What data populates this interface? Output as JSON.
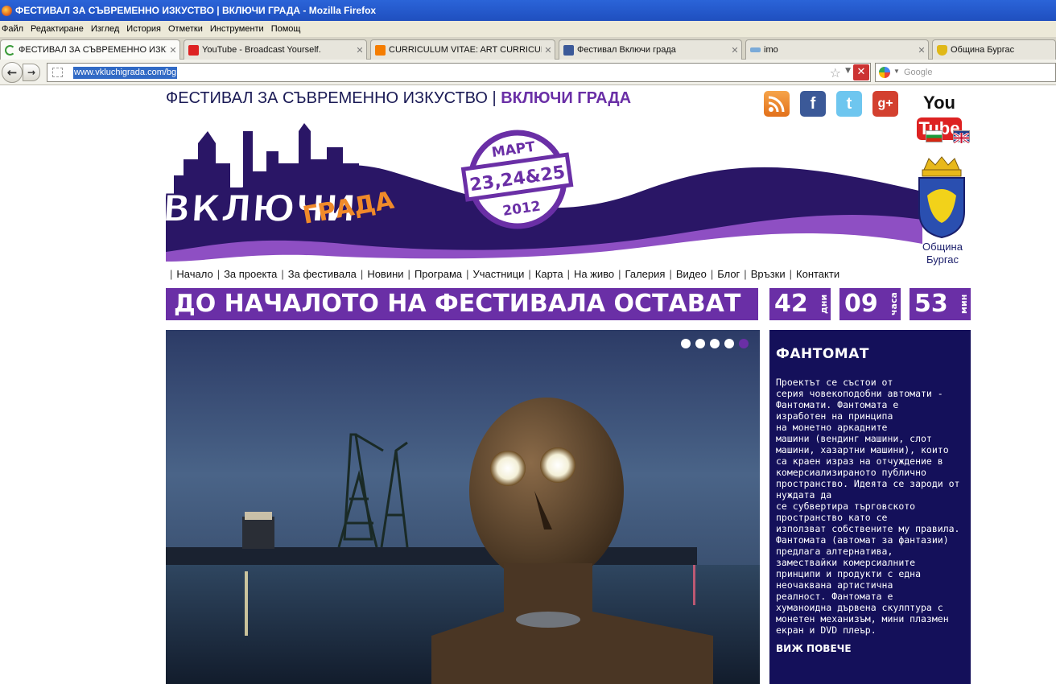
{
  "window": {
    "title": "ФЕСТИВАЛ ЗА СЪВРЕМЕННО ИЗКУСТВО | ВКЛЮЧИ ГРАДА - Mozilla Firefox"
  },
  "menu": [
    "Файл",
    "Редактиране",
    "Изглед",
    "История",
    "Отметки",
    "Инструменти",
    "Помощ"
  ],
  "tabs": [
    {
      "label": "ФЕСТИВАЛ ЗА СЪВРЕМЕННО ИЗКУС...",
      "icon": "loading-icon",
      "active": true
    },
    {
      "label": "YouTube - Broadcast Yourself.",
      "icon": "youtube-icon"
    },
    {
      "label": "CURRICULUM VITAE: ART CURRICUL...",
      "icon": "blogger-icon"
    },
    {
      "label": "Фестивал Включи града",
      "icon": "facebook-icon"
    },
    {
      "label": "imo",
      "icon": "imo-icon"
    },
    {
      "label": "Община Бургас",
      "icon": "crest-icon"
    }
  ],
  "navigation": {
    "url": "www.vkluchigrada.com/bg",
    "search_placeholder": "Google"
  },
  "site": {
    "heading_main": "ФЕСТИВАЛ ЗА СЪВРЕМЕННО ИЗКУСТВО",
    "heading_sep": "|",
    "heading_accent": "ВКЛЮЧИ ГРАДА",
    "social": [
      "rss-icon",
      "facebook-icon",
      "twitter-icon",
      "google-plus-icon",
      "youtube-icon"
    ],
    "youtube_label": "YouTube",
    "languages": [
      "bulgarian-flag-icon",
      "uk-flag-icon"
    ],
    "logo_text": "ВКЛЮЧИ ГРАДА",
    "stamp": {
      "month": "МАРТ",
      "days": "23,24&25",
      "year": "2012"
    },
    "municipality": [
      "Община",
      "Бургас"
    ]
  },
  "nav": [
    "Начало",
    "За проекта",
    "За фестивала",
    "Новини",
    "Програма",
    "Участници",
    "Карта",
    "На живо",
    "Галерия",
    "Видео",
    "Блог",
    "Връзки",
    "Контакти"
  ],
  "countdown": {
    "label": "ДО НАЧАЛОТО НА ФЕСТИВАЛА ОСТАВАТ",
    "days": "42",
    "days_unit": "дни",
    "hours": "09",
    "hours_unit": "часа",
    "minutes": "53",
    "minutes_unit": "мин"
  },
  "slider": {
    "total": 5,
    "active": 5
  },
  "feature": {
    "title": "ФАНТОМАТ",
    "lines": [
      "Проектът се състои от",
      "серия човекоподобни автомати -",
      "Фантомати. Фантомата е",
      "изработен на принципа",
      "на монетно аркадните",
      "машини (вендинг машини, слот",
      "машини, хазартни машини), които",
      "са краен израз на отчуждение в",
      "комерсиализираното публично",
      "пространство. Идеята се зароди от",
      "нуждата да",
      "се субвертира търговското",
      "пространство като се",
      "използват собствените му правила.",
      "Фантомата (автомат за фантазии)",
      "предлага алтернатива,",
      "замествайки комерсиалните",
      "принципи и продукти с една",
      "неочаквана артистична",
      "реалност. Фантомата е",
      "хуманоидна дървена скулптура с",
      "монетен механизъм, мини плазмен",
      "екран и DVD плеър."
    ],
    "more": "ВИЖ ПОВЕЧЕ"
  },
  "colors": {
    "brand_purple": "#6a2fa6",
    "navy": "#14105a"
  }
}
